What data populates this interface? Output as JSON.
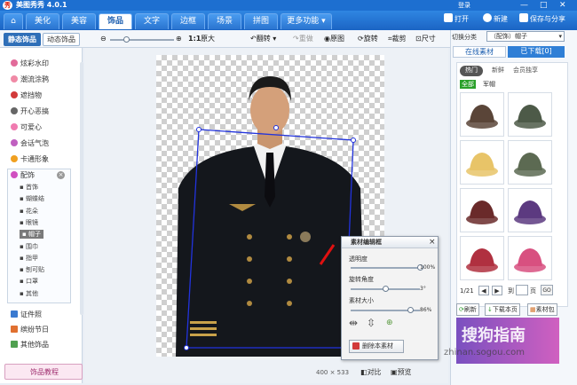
{
  "app": {
    "title": "美图秀秀 4.0.1",
    "logo": "秀",
    "login": "登录"
  },
  "window_controls": [
    "—",
    "□",
    "✕"
  ],
  "tabs": [
    {
      "label": "美化",
      "active": false
    },
    {
      "label": "美容",
      "active": false
    },
    {
      "label": "饰品",
      "active": true
    },
    {
      "label": "文字",
      "active": false
    },
    {
      "label": "边框",
      "active": false
    },
    {
      "label": "场景",
      "active": false
    },
    {
      "label": "拼图",
      "active": false
    },
    {
      "label": "更多功能 ▾",
      "active": false
    }
  ],
  "top_actions": {
    "open": "打开",
    "new": "新建",
    "save_share": "保存与分享"
  },
  "subtabs": {
    "static": "静态饰品",
    "dynamic": "动态饰品"
  },
  "toolbar": {
    "ratio": "1:1",
    "original_size": "原大",
    "rotate": "翻转",
    "redo": "重做",
    "original": "原图",
    "rotate2": "旋转",
    "crop": "裁剪",
    "resize": "尺寸"
  },
  "left_categories": [
    {
      "label": "炫彩水印",
      "icon_color": "#e26b9a"
    },
    {
      "label": "潮流涂鸦",
      "icon_color": "#f08aa6"
    },
    {
      "label": "遮挡物",
      "icon_color": "#d23a3a"
    },
    {
      "label": "开心恶搞",
      "icon_color": "#666666"
    },
    {
      "label": "可爱心",
      "icon_color": "#f07bb0"
    },
    {
      "label": "会话气泡",
      "icon_color": "#c060c0"
    },
    {
      "label": "卡通形象",
      "icon_color": "#f0a020"
    }
  ],
  "accessory_group": {
    "label": "配饰",
    "items": [
      "首饰",
      "蝴蝶结",
      "花朵",
      "眼镜",
      "帽子",
      "围巾",
      "指甲",
      "刨可贴",
      "口罩",
      "其他"
    ],
    "selected": "帽子"
  },
  "bottom_categories": [
    {
      "label": "证件照",
      "icon_color": "#3a7ad0"
    },
    {
      "label": "缤纷节日",
      "icon_color": "#e07030"
    },
    {
      "label": "其他饰品",
      "icon_color": "#50a050"
    }
  ],
  "left_footer": {
    "label": "饰品教程"
  },
  "right": {
    "category_label": "切换分类",
    "category_value": "（配饰）帽子",
    "tab_online": "在线素材",
    "tab_downloaded": "已下载[0]",
    "filters": [
      "热门",
      "新鲜",
      "会员独享"
    ],
    "chips": [
      "全部",
      "军帽"
    ],
    "pager": "1/21",
    "goto_label": "到",
    "page_label": "页",
    "go": "GO",
    "refresh": "刷新",
    "download_page": "下载本页",
    "material_pack": "素材包"
  },
  "hat_colors": [
    "#5a4538",
    "#4d5a48",
    "#e8c468",
    "#5c6a52",
    "#6a2a2a",
    "#5c3a80",
    "#b03040",
    "#d85080"
  ],
  "dialog": {
    "title": "素材编辑框",
    "close": "×",
    "opacity_label": "透明度",
    "opacity_value": "100%",
    "rotation_label": "旋转角度",
    "rotation_value": "3°",
    "size_label": "素材大小",
    "size_value": "86%",
    "delete": "删除本素材"
  },
  "levels": {
    "zoom": 0.25,
    "opacity": 1.0,
    "rotation": 0.5,
    "size": 0.86
  },
  "status": {
    "dimensions": "400 × 533",
    "compare": "对比",
    "preview": "预览"
  },
  "watermark": {
    "brand": "搜狗指南",
    "url": "zhinan.sogou.com"
  }
}
